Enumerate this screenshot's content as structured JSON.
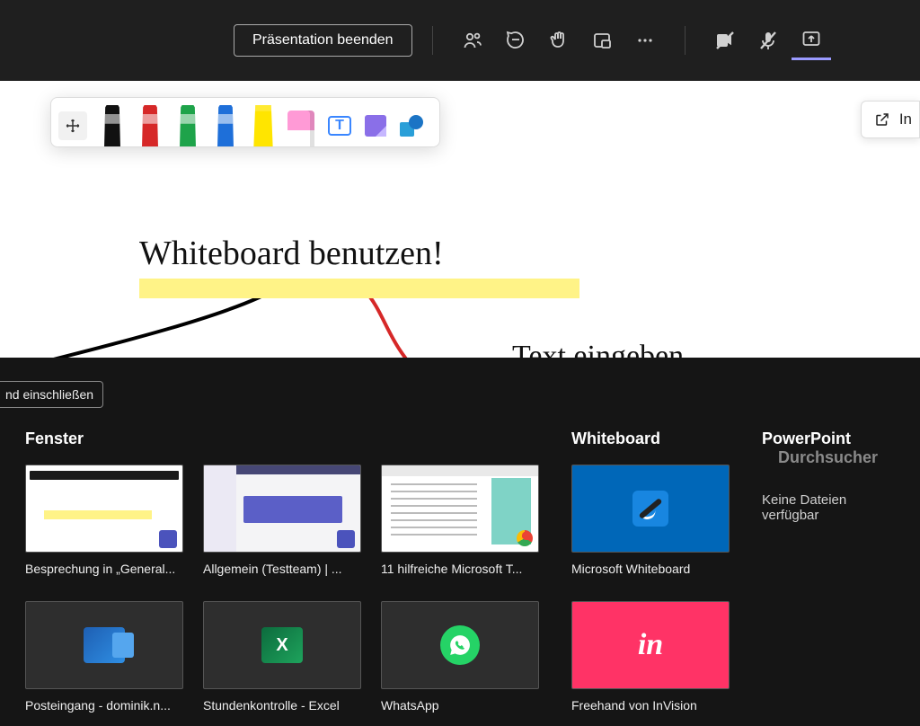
{
  "topbar": {
    "end_presentation": "Präsentation beenden"
  },
  "whiteboard": {
    "open_label": "In",
    "ink_text_1": "Whiteboard benutzen!",
    "ink_text_2": "Text eingeben",
    "tools": {
      "text_tool_glyph": "T"
    }
  },
  "tray": {
    "include_partial": "nd einschließen",
    "sections": {
      "windows": "Fenster",
      "whiteboard": "Whiteboard",
      "powerpoint": "PowerPoint",
      "browse": "Durchsucher"
    },
    "no_files": "Keine Dateien verfügbar",
    "tiles": {
      "window": [
        "Besprechung in „General...",
        "Allgemein (Testteam) | ...",
        "11 hilfreiche Microsoft T...",
        "Posteingang - dominik.n...",
        "Stundenkontrolle - Excel",
        "WhatsApp"
      ],
      "whiteboard": [
        "Microsoft Whiteboard",
        "Freehand von InVision"
      ]
    },
    "excel_glyph": "X",
    "invision_glyph": "in"
  }
}
